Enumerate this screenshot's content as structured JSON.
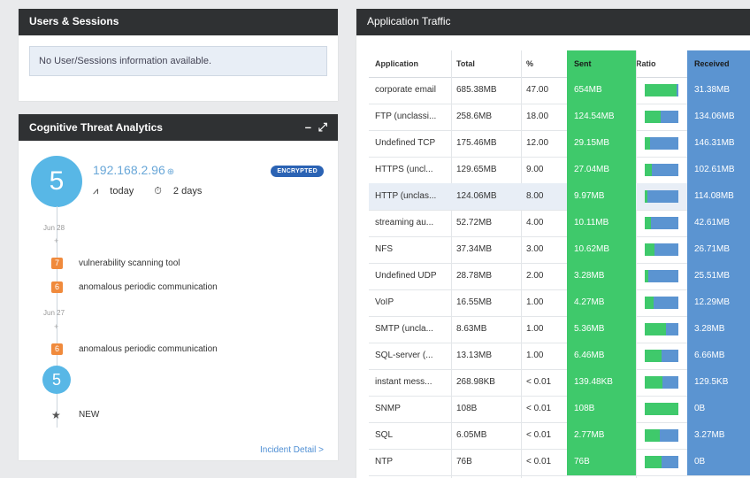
{
  "users_panel": {
    "title": "Users & Sessions",
    "message": "No User/Sessions information available."
  },
  "cta_panel": {
    "title": "Cognitive Threat Analytics",
    "controls": "– ⤢",
    "score": "5",
    "ip": "192.168.2.96",
    "badge": "ENCRYPTED",
    "today_label": "today",
    "duration_label": "2 days",
    "dates": [
      "Jun 28",
      "Jun 27"
    ],
    "events": [
      {
        "score": "7",
        "text": "vulnerability scanning tool"
      },
      {
        "score": "6",
        "text": "anomalous periodic communication"
      },
      {
        "score": "6",
        "text": "anomalous periodic communication"
      }
    ],
    "small_score": "5",
    "new_label": "NEW",
    "link": "Incident Detail >"
  },
  "traffic_panel": {
    "title": "Application Traffic",
    "columns": [
      "Application",
      "Total",
      "%",
      "Sent",
      "Ratio",
      "Received"
    ],
    "rows": [
      {
        "app": "corporate email",
        "total": "685.38MB",
        "pct": "47.00",
        "sent": "654MB",
        "ratio": 0.95,
        "recv": "31.38MB"
      },
      {
        "app": "FTP (unclassi...",
        "total": "258.6MB",
        "pct": "18.00",
        "sent": "124.54MB",
        "ratio": 0.48,
        "recv": "134.06MB"
      },
      {
        "app": "Undefined TCP",
        "total": "175.46MB",
        "pct": "12.00",
        "sent": "29.15MB",
        "ratio": 0.17,
        "recv": "146.31MB"
      },
      {
        "app": "HTTPS (uncl...",
        "total": "129.65MB",
        "pct": "9.00",
        "sent": "27.04MB",
        "ratio": 0.21,
        "recv": "102.61MB"
      },
      {
        "app": "HTTP (unclas...",
        "total": "124.06MB",
        "pct": "8.00",
        "sent": "9.97MB",
        "ratio": 0.08,
        "recv": "114.08MB"
      },
      {
        "app": "streaming au...",
        "total": "52.72MB",
        "pct": "4.00",
        "sent": "10.11MB",
        "ratio": 0.19,
        "recv": "42.61MB"
      },
      {
        "app": "NFS",
        "total": "37.34MB",
        "pct": "3.00",
        "sent": "10.62MB",
        "ratio": 0.28,
        "recv": "26.71MB"
      },
      {
        "app": "Undefined UDP",
        "total": "28.78MB",
        "pct": "2.00",
        "sent": "3.28MB",
        "ratio": 0.11,
        "recv": "25.51MB"
      },
      {
        "app": "VoIP",
        "total": "16.55MB",
        "pct": "1.00",
        "sent": "4.27MB",
        "ratio": 0.26,
        "recv": "12.29MB"
      },
      {
        "app": "SMTP (uncla...",
        "total": "8.63MB",
        "pct": "1.00",
        "sent": "5.36MB",
        "ratio": 0.62,
        "recv": "3.28MB"
      },
      {
        "app": "SQL-server (...",
        "total": "13.13MB",
        "pct": "1.00",
        "sent": "6.46MB",
        "ratio": 0.49,
        "recv": "6.66MB"
      },
      {
        "app": "instant mess...",
        "total": "268.98KB",
        "pct": "< 0.01",
        "sent": "139.48KB",
        "ratio": 0.52,
        "recv": "129.5KB"
      },
      {
        "app": "SNMP",
        "total": "108B",
        "pct": "< 0.01",
        "sent": "108B",
        "ratio": 1.0,
        "recv": "0B"
      },
      {
        "app": "SQL",
        "total": "6.05MB",
        "pct": "< 0.01",
        "sent": "2.77MB",
        "ratio": 0.46,
        "recv": "3.27MB"
      },
      {
        "app": "NTP",
        "total": "76B",
        "pct": "< 0.01",
        "sent": "76B",
        "ratio": 0.5,
        "recv": "0B"
      }
    ]
  },
  "colors": {
    "sent": "#3fc96b",
    "received": "#5b94d1",
    "header": "#2f3133",
    "accent": "#58b7e6",
    "badge_orange": "#f08a3c"
  }
}
